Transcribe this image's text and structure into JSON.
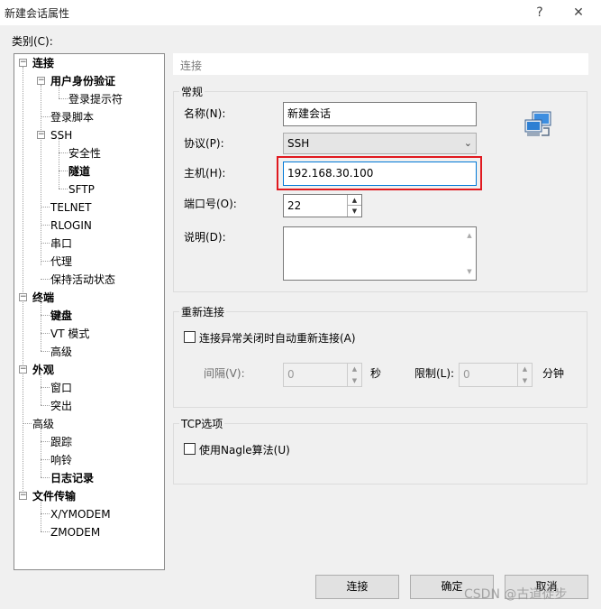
{
  "window": {
    "title": "新建会话属性",
    "help_glyph": "?",
    "close_glyph": "✕"
  },
  "category": {
    "label": "类别(C):",
    "tree": {
      "connection": "连接",
      "user_auth": "用户身份验证",
      "login_prompts": "登录提示符",
      "login_script": "登录脚本",
      "ssh": "SSH",
      "security": "安全性",
      "tunnel": "隧道",
      "sftp": "SFTP",
      "telnet": "TELNET",
      "rlogin": "RLOGIN",
      "serial": "串口",
      "proxy": "代理",
      "keepalive": "保持活动状态",
      "terminal": "终端",
      "keyboard": "键盘",
      "vt_mode": "VT 模式",
      "advanced": "高级",
      "appearance": "外观",
      "window": "窗口",
      "highlight": "突出",
      "advanced2": "高级",
      "trace": "跟踪",
      "bell": "响铃",
      "logging": "日志记录",
      "file_transfer": "文件传输",
      "xymodem": "X/YMODEM",
      "zmodem": "ZMODEM"
    }
  },
  "panel": {
    "header": "连接",
    "general": {
      "title": "常规",
      "name_label": "名称(N):",
      "name_value": "新建会话",
      "protocol_label": "协议(P):",
      "protocol_value": "SSH",
      "host_label": "主机(H):",
      "host_value": "192.168.30.100",
      "port_label": "端口号(O):",
      "port_value": "22",
      "desc_label": "说明(D):"
    },
    "reconnect": {
      "title": "重新连接",
      "checkbox_label": "连接异常关闭时自动重新连接(A)",
      "checked": false,
      "interval_label": "间隔(V):",
      "interval_value": "0",
      "interval_unit": "秒",
      "limit_label": "限制(L):",
      "limit_value": "0",
      "limit_unit": "分钟"
    },
    "tcp": {
      "title": "TCP选项",
      "nagle_label": "使用Nagle算法(U)",
      "checked": false
    }
  },
  "buttons": {
    "connect": "连接",
    "ok": "确定",
    "cancel": "取消"
  },
  "watermark": "CSDN @古道徒步",
  "colors": {
    "highlight_border": "#e0191f",
    "window_bg": "#f0f0f0"
  },
  "icons": {
    "session": "network-computer-icon"
  }
}
